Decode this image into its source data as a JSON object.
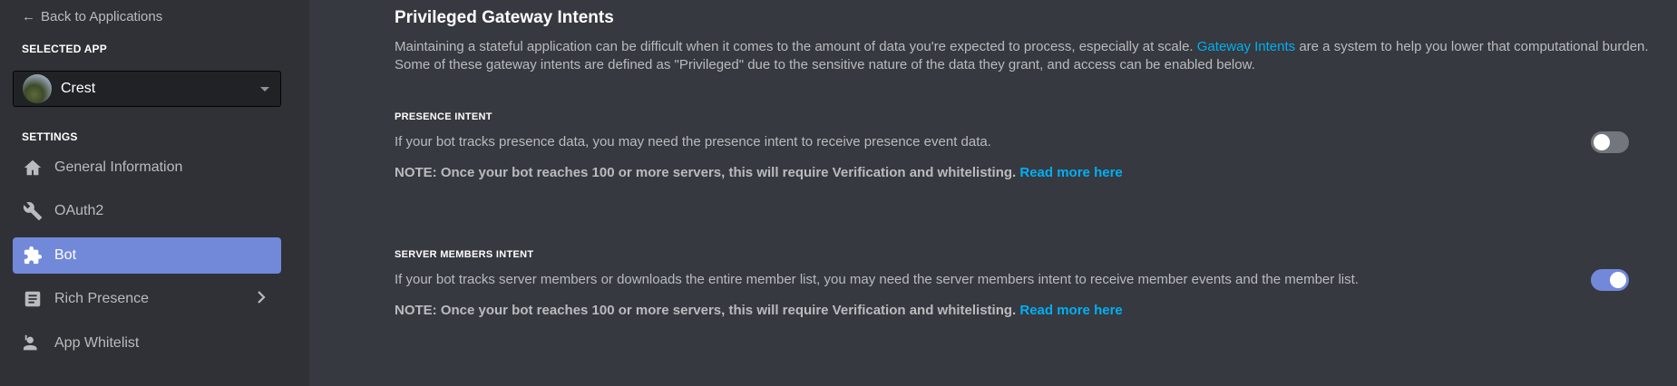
{
  "sidebar": {
    "back_label": "Back to Applications",
    "selected_app_heading": "SELECTED APP",
    "app_name": "Crest",
    "settings_heading": "SETTINGS",
    "items": [
      {
        "label": "General Information",
        "icon": "home-icon"
      },
      {
        "label": "OAuth2",
        "icon": "wrench-icon"
      },
      {
        "label": "Bot",
        "icon": "puzzle-icon",
        "active": true
      },
      {
        "label": "Rich Presence",
        "icon": "document-icon",
        "has_submenu": true
      },
      {
        "label": "App Whitelist",
        "icon": "person-icon"
      }
    ]
  },
  "main": {
    "title": "Privileged Gateway Intents",
    "intro_before": "Maintaining a stateful application can be difficult when it comes to the amount of data you're expected to process, especially at scale. ",
    "intro_link": "Gateway Intents",
    "intro_after": " are a system to help you lower that computational burden. Some of these gateway intents are defined as \"Privileged\" due to the sensitive nature of the data they grant, and access can be enabled below.",
    "intents": [
      {
        "label": "PRESENCE INTENT",
        "description": "If your bot tracks presence data, you may need the presence intent to receive presence event data.",
        "note": "NOTE: Once your bot reaches 100 or more servers, this will require Verification and whitelisting.",
        "note_link": "Read more here",
        "enabled": false
      },
      {
        "label": "SERVER MEMBERS INTENT",
        "description": "If your bot tracks server members or downloads the entire member list, you may need the server members intent to receive member events and the member list.",
        "note": "NOTE: Once your bot reaches 100 or more servers, this will require Verification and whitelisting.",
        "note_link": "Read more here",
        "enabled": true
      }
    ]
  },
  "colors": {
    "accent": "#7289da",
    "link": "#00b0f4",
    "sidebar_bg": "#2f3136",
    "main_bg": "#36393f"
  }
}
